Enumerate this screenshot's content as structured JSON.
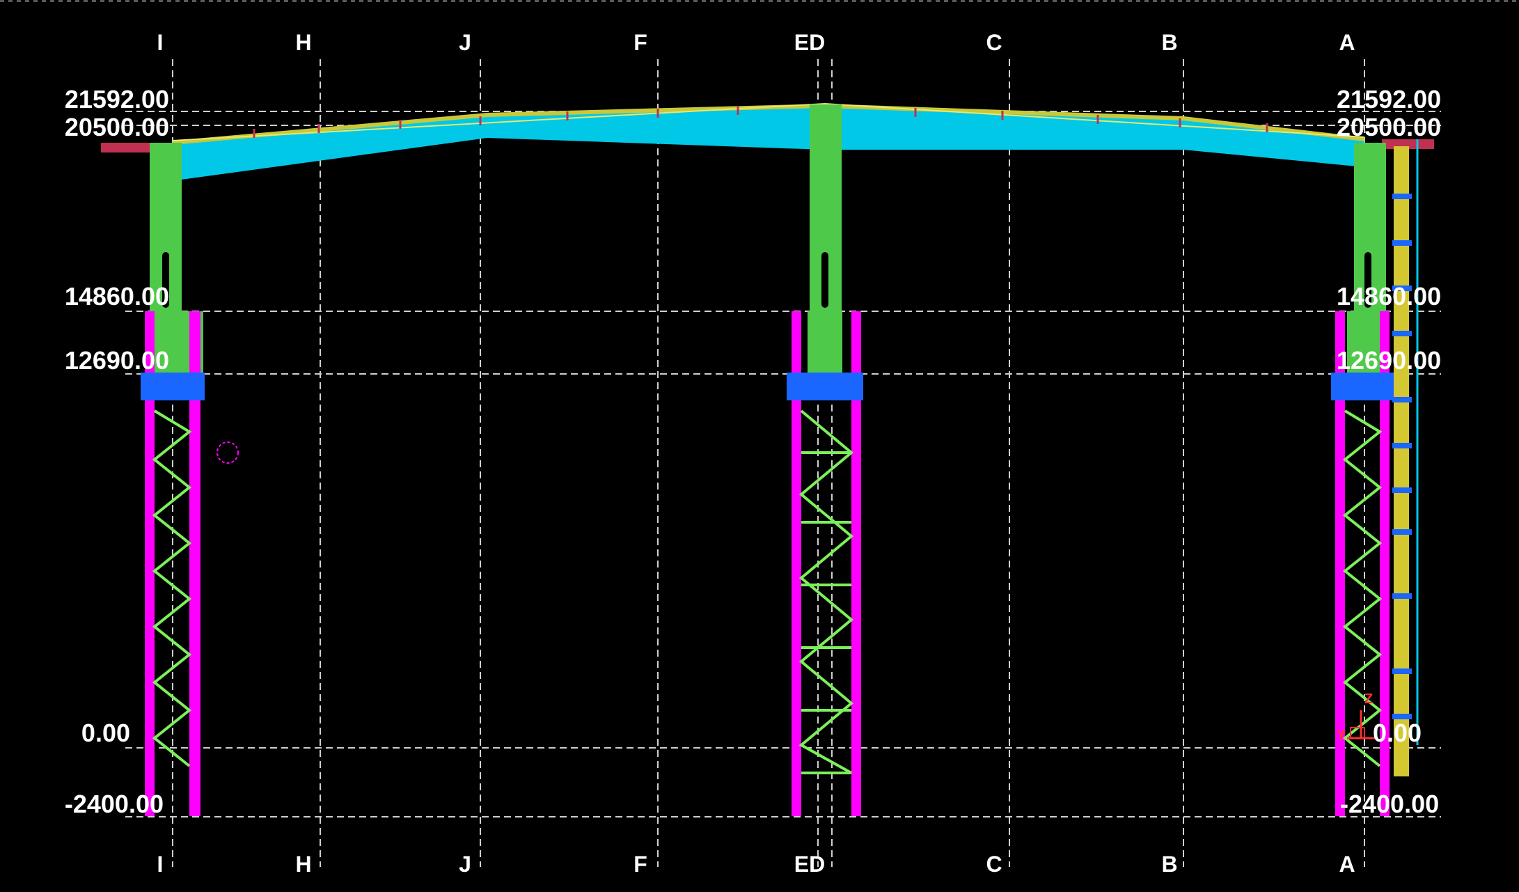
{
  "grid_labels": [
    "I",
    "H",
    "J",
    "F",
    "ED",
    "C",
    "B",
    "A"
  ],
  "levels_left": [
    "21592.00",
    "20500.00",
    "14860.00",
    "12690.00",
    "0.00",
    "-2400.00"
  ],
  "levels_right": [
    "21592.00",
    "20500.00",
    "14860.00",
    "12690.00",
    "0.00",
    "-2400.00"
  ],
  "axis_indicator": {
    "x_label": "Y",
    "z_label": "Z"
  },
  "colors": {
    "grid": "#cfcfcf",
    "text": "#ffffff",
    "roof": "#00c8e6",
    "roof_top": "#c8c83a",
    "upper_column": "#4fc94a",
    "lower_column": "#ff00ff",
    "bracing": "#7cf05a",
    "base_plate": "#1a66ff",
    "cladding": "#d4c832",
    "rafter_purlin": "#c03050"
  }
}
